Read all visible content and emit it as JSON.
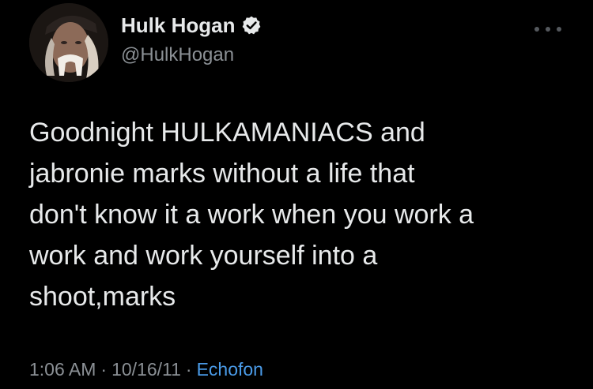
{
  "tweet": {
    "author": {
      "display_name": "Hulk Hogan",
      "handle": "@HulkHogan",
      "verified": true,
      "verified_icon": "verified-badge-icon",
      "avatar": "avatar-photo"
    },
    "more_icon": "more-options-icon",
    "text": "Goodnight HULKAMANIACS and\njabronie marks without a life that\ndon't know it a work when you work a\nwork and work yourself into a\nshoot,marks",
    "time": "1:06 AM",
    "separator": "·",
    "date": "10/16/11",
    "source": "Echofon"
  },
  "colors": {
    "background": "#000000",
    "primary_text": "#e7e9ea",
    "secondary_text": "#8b9095",
    "link": "#4a9be8"
  }
}
